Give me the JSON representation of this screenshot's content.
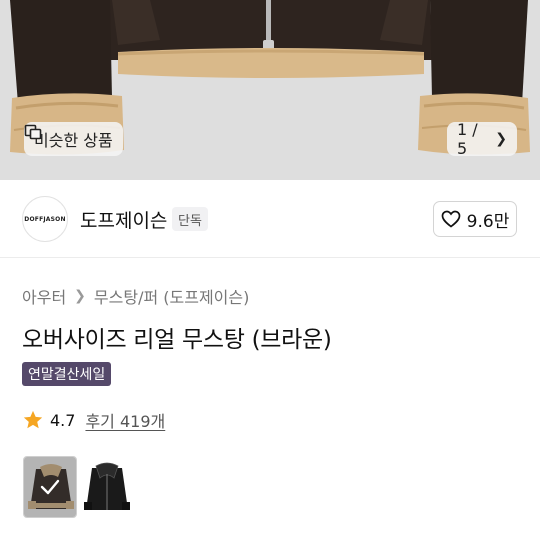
{
  "hero": {
    "similar_label": "비슷한 상품",
    "similar_icon": "similar-items-icon",
    "pager_text": "1 / 5",
    "next_icon": "chevron-right-icon"
  },
  "brand": {
    "logo_text": "DOFFJASON",
    "name": "도프제이슨",
    "badge": "단독",
    "like_count": "9.6만",
    "like_icon": "heart-outline-icon"
  },
  "breadcrumb": {
    "items": [
      "아우터",
      "무스탕/퍼 (도프제이슨)"
    ],
    "separator_icon": "chevron-right-icon"
  },
  "product": {
    "title": "오버사이즈 리얼 무스탕 (브라운)",
    "promo_badge": "연말결산세일"
  },
  "rating": {
    "star_icon": "star-icon",
    "score": "4.7",
    "reviews": "후기 419개"
  },
  "colors": {
    "promo_bg": "#55496a",
    "star": "#f5a623",
    "jacket_brown": "#2e241f",
    "shearling": "#d9b98a",
    "jacket_black": "#1a1a1a"
  },
  "thumbnails": [
    {
      "name": "brown-variant",
      "selected": true
    },
    {
      "name": "black-variant",
      "selected": false
    }
  ]
}
